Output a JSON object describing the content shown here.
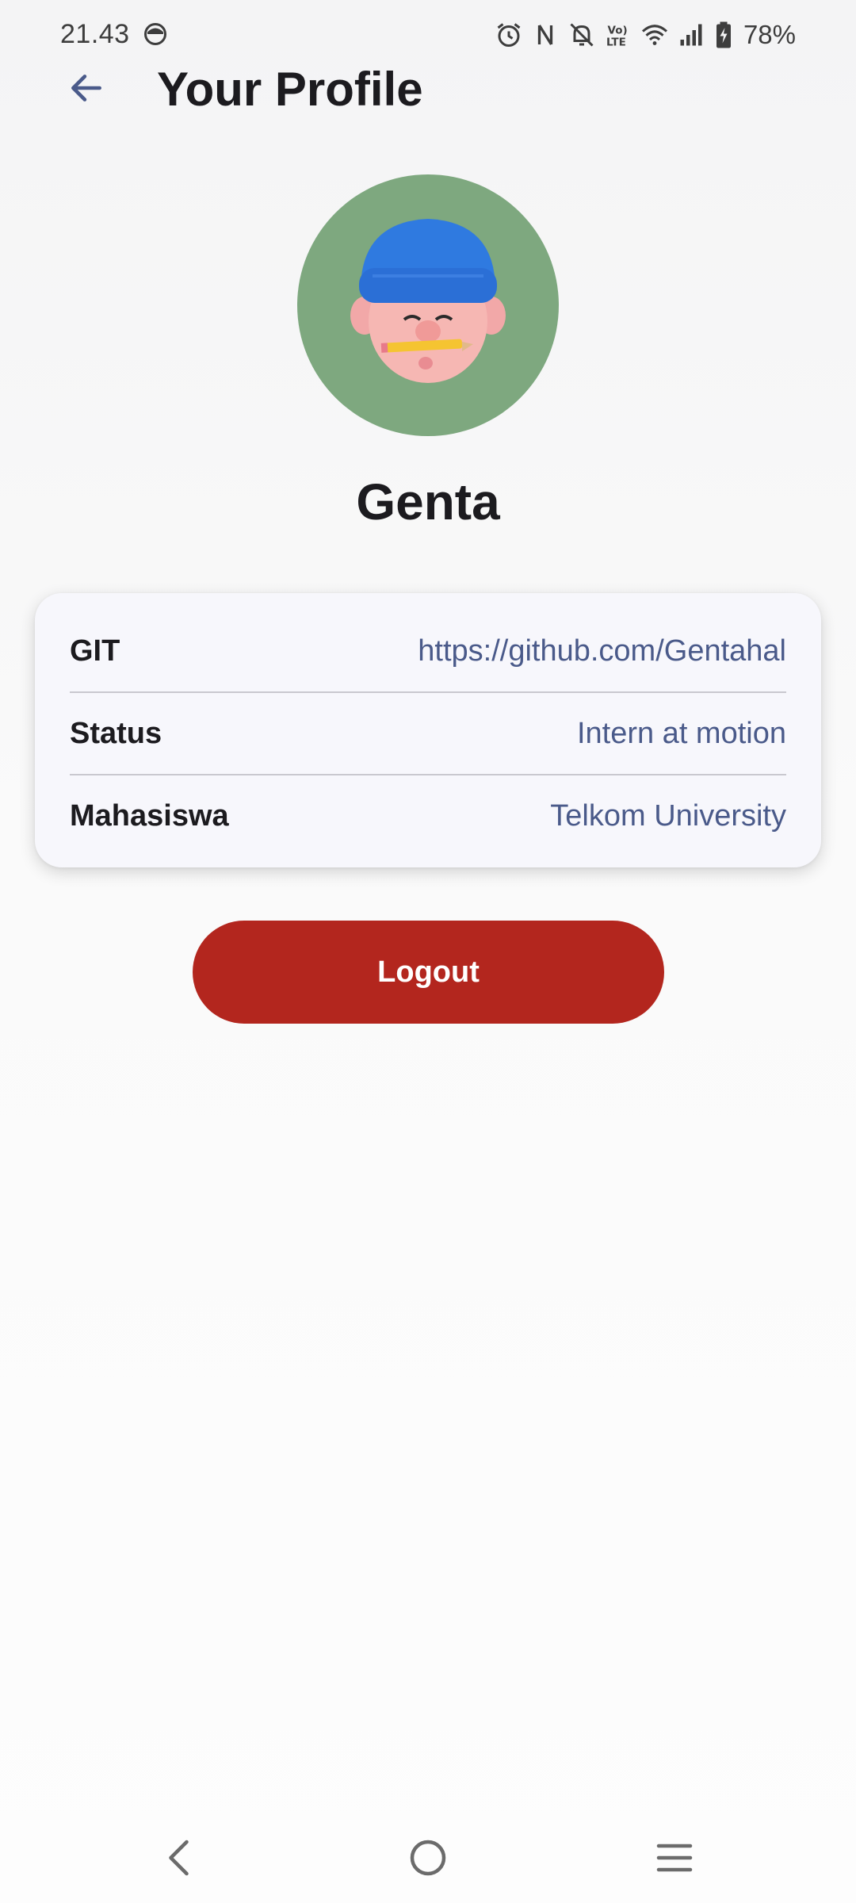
{
  "status_bar": {
    "time": "21.43",
    "battery": "78%",
    "icons": [
      "face-notification-icon",
      "alarm-icon",
      "nfc-icon",
      "silent-icon",
      "volte-icon",
      "wifi-icon",
      "signal-icon",
      "battery-icon"
    ]
  },
  "app_bar": {
    "title": "Your Profile",
    "back_icon": "arrow-back-icon"
  },
  "profile": {
    "name": "Genta",
    "avatar_background": "#7ea87f"
  },
  "info": [
    {
      "label": "GIT",
      "value": "https://github.com/Gentahal"
    },
    {
      "label": "Status",
      "value": "Intern at motion"
    },
    {
      "label": "Mahasiswa",
      "value": "Telkom University"
    }
  ],
  "actions": {
    "logout_label": "Logout",
    "logout_color": "#b3261e"
  },
  "colors": {
    "value_text": "#4a5a8a",
    "title_text": "#1c1b1f",
    "card_background": "#f7f7fc"
  },
  "nav_bar": {
    "icons": [
      "back-nav-icon",
      "home-nav-icon",
      "recents-nav-icon"
    ]
  }
}
